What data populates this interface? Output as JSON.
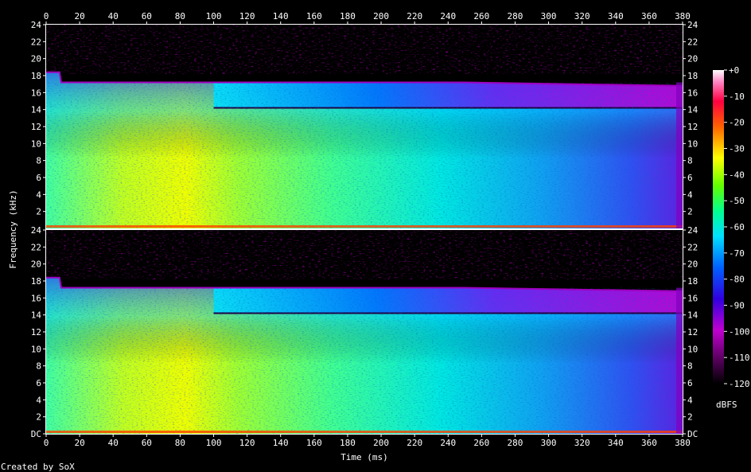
{
  "footer": {
    "credit": "Created by SoX"
  },
  "chart_data": {
    "type": "heatmap",
    "title": "",
    "xlabel": "Time (ms)",
    "ylabel": "Frequency (kHz)",
    "xlim": [
      0,
      380
    ],
    "x_ticks": [
      0,
      20,
      40,
      60,
      80,
      100,
      120,
      140,
      160,
      180,
      200,
      220,
      240,
      260,
      280,
      300,
      320,
      340,
      360,
      380
    ],
    "channels": [
      {
        "ylim": [
          0,
          24
        ],
        "y_tick_labels": [
          "24",
          "22",
          "20",
          "18",
          "16",
          "14",
          "12",
          "10",
          "8",
          "6",
          "4",
          "2"
        ]
      },
      {
        "ylim": [
          0,
          24
        ],
        "y_tick_labels": [
          "24",
          "22",
          "20",
          "18",
          "16",
          "14",
          "12",
          "10",
          "8",
          "6",
          "4",
          "2",
          "DC"
        ]
      }
    ],
    "colorbar": {
      "label": "dBFS",
      "range": [
        -120,
        0
      ],
      "tick_labels": [
        "+0",
        "-10",
        "-20",
        "-30",
        "-40",
        "-50",
        "-60",
        "-70",
        "-80",
        "-90",
        "-100",
        "-110",
        "-120"
      ]
    },
    "features": {
      "upper_cutoff_khz_start": 18.4,
      "upper_cutoff_khz_after_10ms": 17.2,
      "upper_cutoff_khz_end": 16.8,
      "step_change_ms": 100,
      "secondary_band_khz": 14.2,
      "loud_region_ms": [
        20,
        100
      ],
      "loud_region_dbfs": -40,
      "late_region_dbfs": -80
    },
    "colors": {
      "background": "#000000",
      "grid_text": "#ffffff"
    }
  }
}
